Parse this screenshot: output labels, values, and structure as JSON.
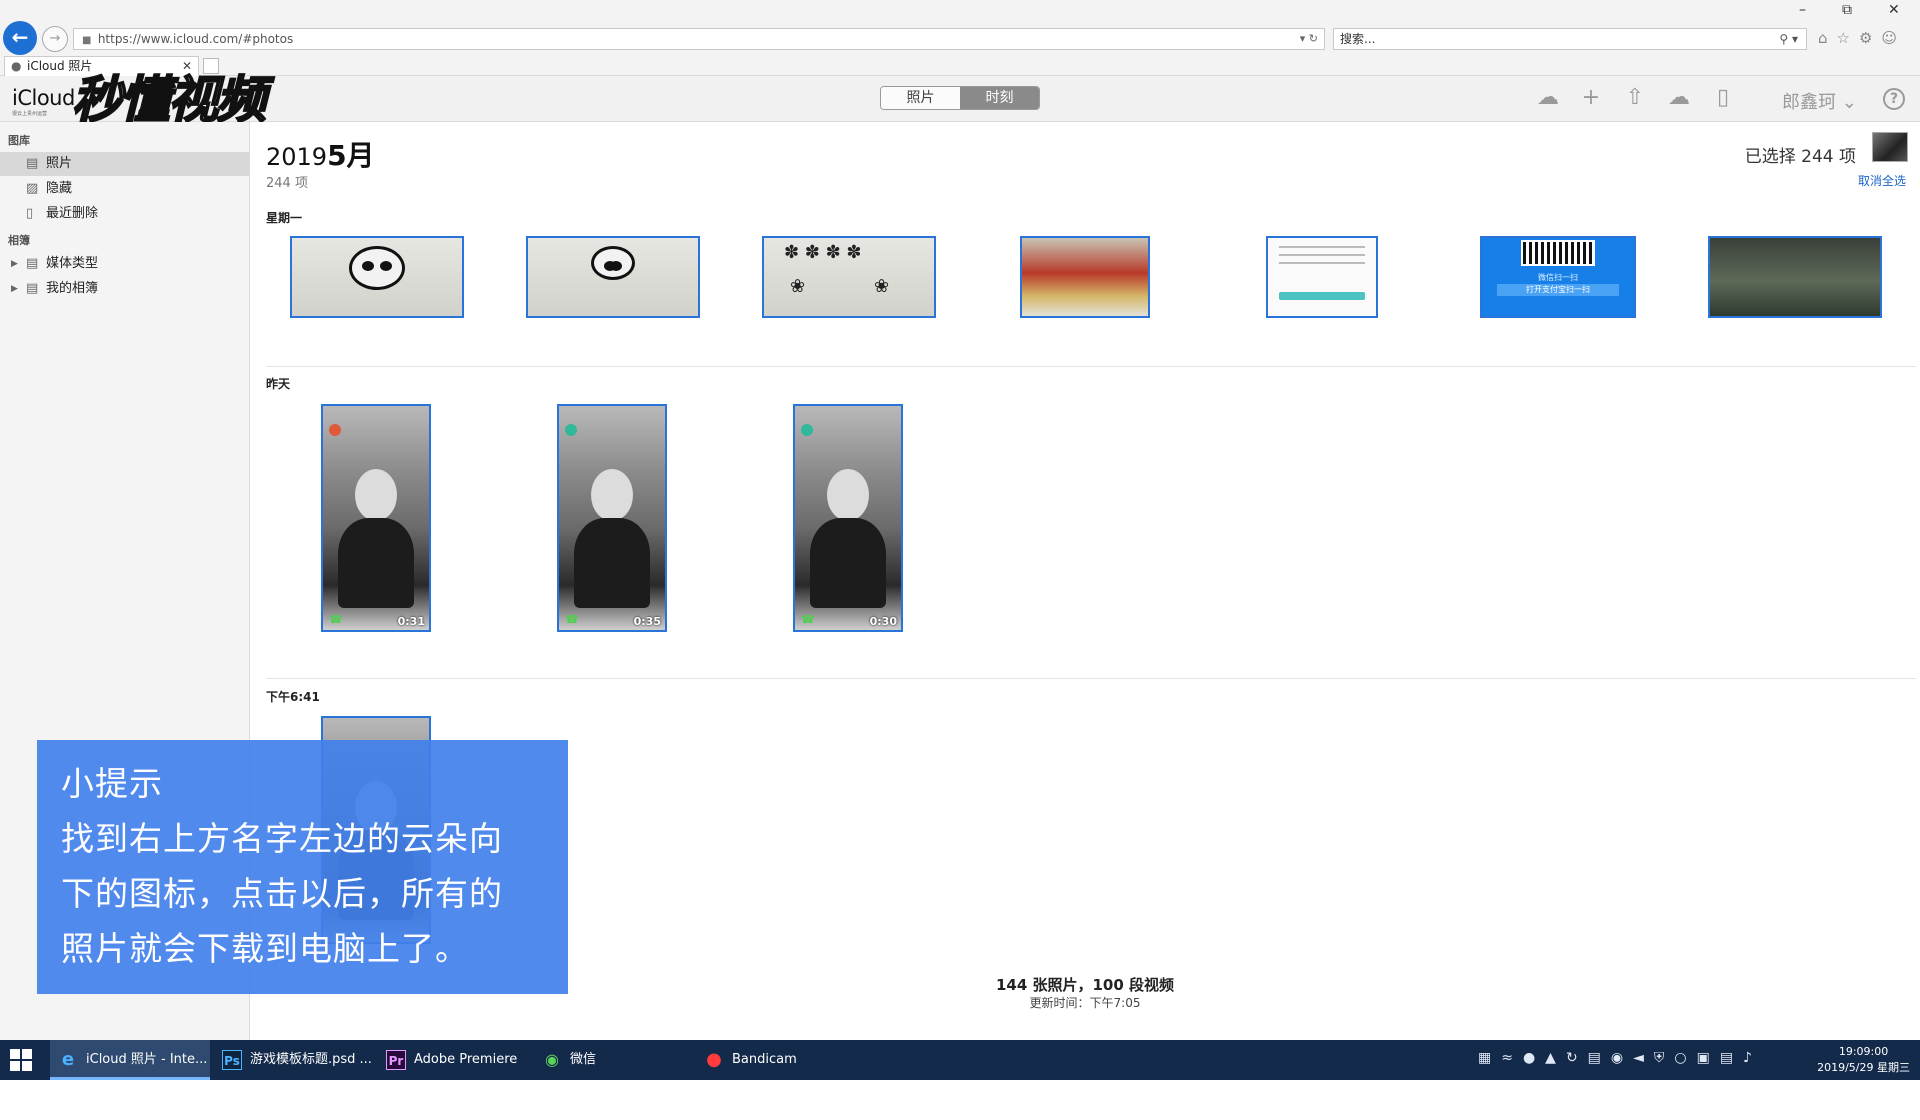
{
  "browser": {
    "url": "https://www.icloud.com/#photos",
    "search_placeholder": "搜索...",
    "tab_title": "iCloud 照片"
  },
  "header": {
    "logo": "iCloud",
    "logo_sub": "很云上贵州运营",
    "watermark": "秒懂视频",
    "seg_photos": "照片",
    "seg_moments": "时刻",
    "user_name": "郎鑫珂 ⌄"
  },
  "sidebar": {
    "library_label": "图库",
    "items": [
      "照片",
      "隐藏",
      "最近删除"
    ],
    "albums_label": "相簿",
    "albums": [
      "媒体类型",
      "我的相簿"
    ]
  },
  "main": {
    "month_prefix": "2019",
    "month_bold": "5月",
    "count": "244 项",
    "selected_text": "已选择 244 项",
    "deselect_all": "取消全选",
    "sections": {
      "monday": "星期一",
      "yesterday": "昨天",
      "time": "下午6:41"
    },
    "durations": [
      "0:31",
      "0:35",
      "0:30"
    ],
    "doc_btn_caption": "打开支付宝扫一扫",
    "qr_caption": "微信扫一扫",
    "footer_count": "144 张照片，100 段视频",
    "footer_updated": "更新时间：下午7:05"
  },
  "tip": {
    "title": "小提示",
    "lines": [
      "找到右上方名字左边的云朵向",
      "下的图标，点击以后，所有的",
      "照片就会下载到电脑上了。"
    ]
  },
  "taskbar": {
    "tasks": [
      "iCloud 照片 - Inte...",
      "游戏模板标题.psd ...",
      "Adobe Premiere ...",
      "微信",
      "Bandicam"
    ],
    "time": "19:09:00",
    "date": "2019/5/29 星期三"
  },
  "colors": {
    "accent": "#2a73d9",
    "tip_bg": "#4280ec",
    "taskbar": "#132a4a"
  }
}
